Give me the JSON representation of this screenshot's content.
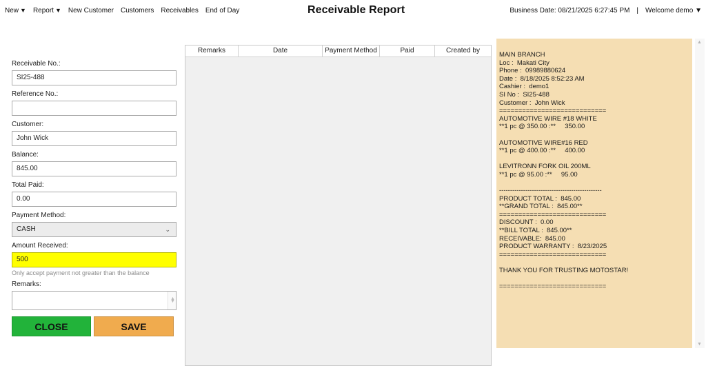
{
  "menu": [
    {
      "label": "New",
      "caret": "▼"
    },
    {
      "label": "Report",
      "caret": "▼"
    },
    {
      "label": "New Customer",
      "caret": ""
    },
    {
      "label": "Customers",
      "caret": ""
    },
    {
      "label": "Receivables",
      "caret": ""
    },
    {
      "label": "End of Day",
      "caret": ""
    }
  ],
  "header": {
    "title": "Receivable Report",
    "business_date": "Business Date: 08/21/2025 6:27:45 PM",
    "separator": "|",
    "welcome": "Welcome demo",
    "welcome_caret": "▼"
  },
  "form": {
    "receivable_no_label": "Receivable No.:",
    "receivable_no": "SI25-488",
    "reference_no_label": "Reference No.:",
    "reference_no": "",
    "customer_label": "Customer:",
    "customer": "John Wick",
    "balance_label": "Balance:",
    "balance": "845.00",
    "total_paid_label": "Total Paid:",
    "total_paid": "0.00",
    "payment_method_label": "Payment Method:",
    "payment_method": "CASH",
    "amount_received_label": "Amount Received:",
    "amount_received": "500",
    "amount_hint": "Only accept payment not greater than the balance",
    "remarks_label": "Remarks:",
    "remarks": ""
  },
  "buttons": {
    "close": "CLOSE",
    "save": "SAVE"
  },
  "grid": {
    "columns": [
      "Remarks",
      "Date",
      "Payment Method",
      "Paid",
      "Created by"
    ],
    "rows": []
  },
  "receipt": {
    "lines": [
      "MAIN BRANCH",
      "Loc :  Makati City",
      "Phone :  09989880624",
      "Date :  8/18/2025 8:52:23 AM",
      "Cashier :  demo1",
      "SI No :  SI25-488",
      "Customer :  John Wick",
      "============================",
      "AUTOMOTIVE WIRE #18 WHITE",
      "**1 pc @ 350.00 :**     350.00",
      "",
      "AUTOMOTIVE WIRE#16 RED",
      "**1 pc @ 400.00 :**     400.00",
      "",
      "LEVITRONN FORK OIL 200ML",
      "**1 pc @ 95.00 :**     95.00",
      "",
      "-----------------------------------------------",
      "PRODUCT TOTAL :  845.00",
      "**GRAND TOTAL :  845.00**",
      "============================",
      "DISCOUNT :  0.00",
      "**BILL TOTAL :  845.00**",
      "RECEIVABLE:  845.00",
      "PRODUCT WARRANTY :  8/23/2025",
      "============================",
      "",
      "THANK YOU FOR TRUSTING MOTOSTAR!",
      "",
      "============================"
    ]
  },
  "colors": {
    "close_button": "#22b33a",
    "save_button": "#f0ab4e",
    "amount_highlight": "#ffff00",
    "receipt_bg": "#f5deb3"
  }
}
